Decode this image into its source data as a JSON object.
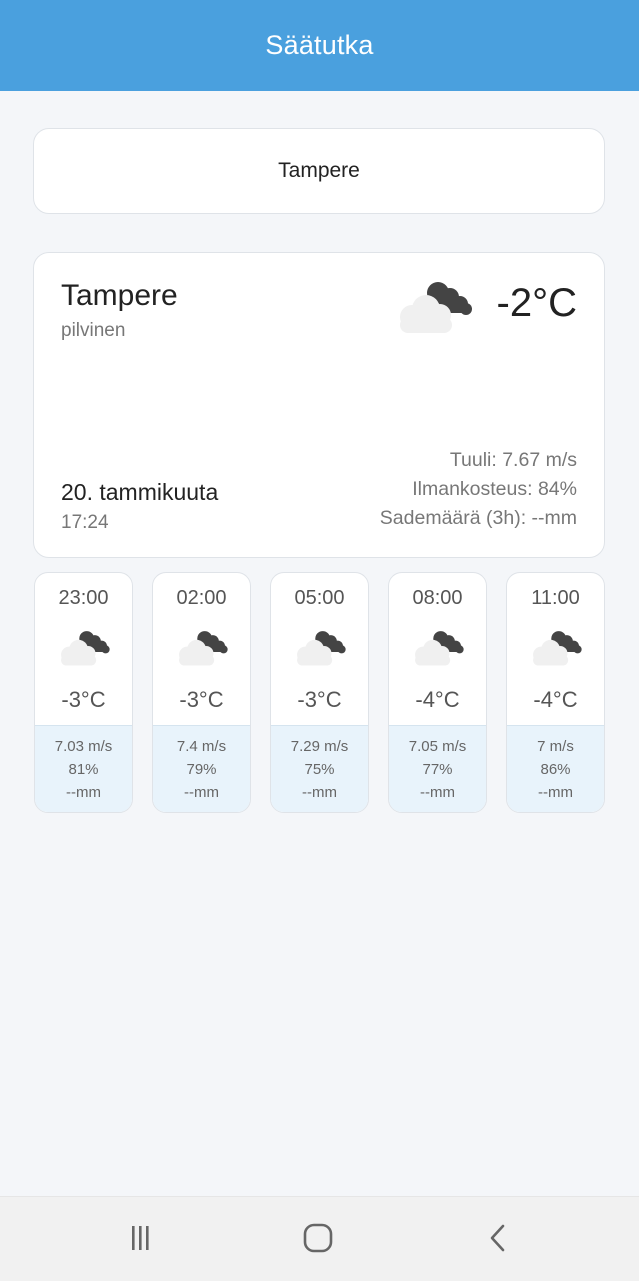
{
  "app": {
    "title": "Säätutka"
  },
  "search": {
    "value": "Tampere"
  },
  "current": {
    "city": "Tampere",
    "description": "pilvinen",
    "temperature": "-2°C",
    "date": "20. tammikuuta",
    "time": "17:24",
    "wind": "Tuuli: 7.67 m/s",
    "humidity": "Ilmankosteus: 84%",
    "precipitation": "Sademäärä (3h): --mm",
    "icon": "cloudy-night-icon"
  },
  "forecast": [
    {
      "time": "23:00",
      "temp": "-3°C",
      "wind": "7.03 m/s",
      "humidity": "81%",
      "precip": "--mm",
      "icon": "cloudy-night-icon"
    },
    {
      "time": "02:00",
      "temp": "-3°C",
      "wind": "7.4 m/s",
      "humidity": "79%",
      "precip": "--mm",
      "icon": "cloudy-night-icon"
    },
    {
      "time": "05:00",
      "temp": "-3°C",
      "wind": "7.29 m/s",
      "humidity": "75%",
      "precip": "--mm",
      "icon": "cloudy-night-icon"
    },
    {
      "time": "08:00",
      "temp": "-4°C",
      "wind": "7.05 m/s",
      "humidity": "77%",
      "precip": "--mm",
      "icon": "cloudy-night-icon"
    },
    {
      "time": "11:00",
      "temp": "-4°C",
      "wind": "7 m/s",
      "humidity": "86%",
      "precip": "--mm",
      "icon": "cloudy-night-icon"
    }
  ],
  "colors": {
    "appbar": "#4aa0de",
    "forecast_detail_bg": "#e8f3fb",
    "background": "#f4f6f9"
  },
  "navigation": {
    "buttons": [
      "recent-apps-icon",
      "home-icon",
      "back-icon"
    ]
  }
}
